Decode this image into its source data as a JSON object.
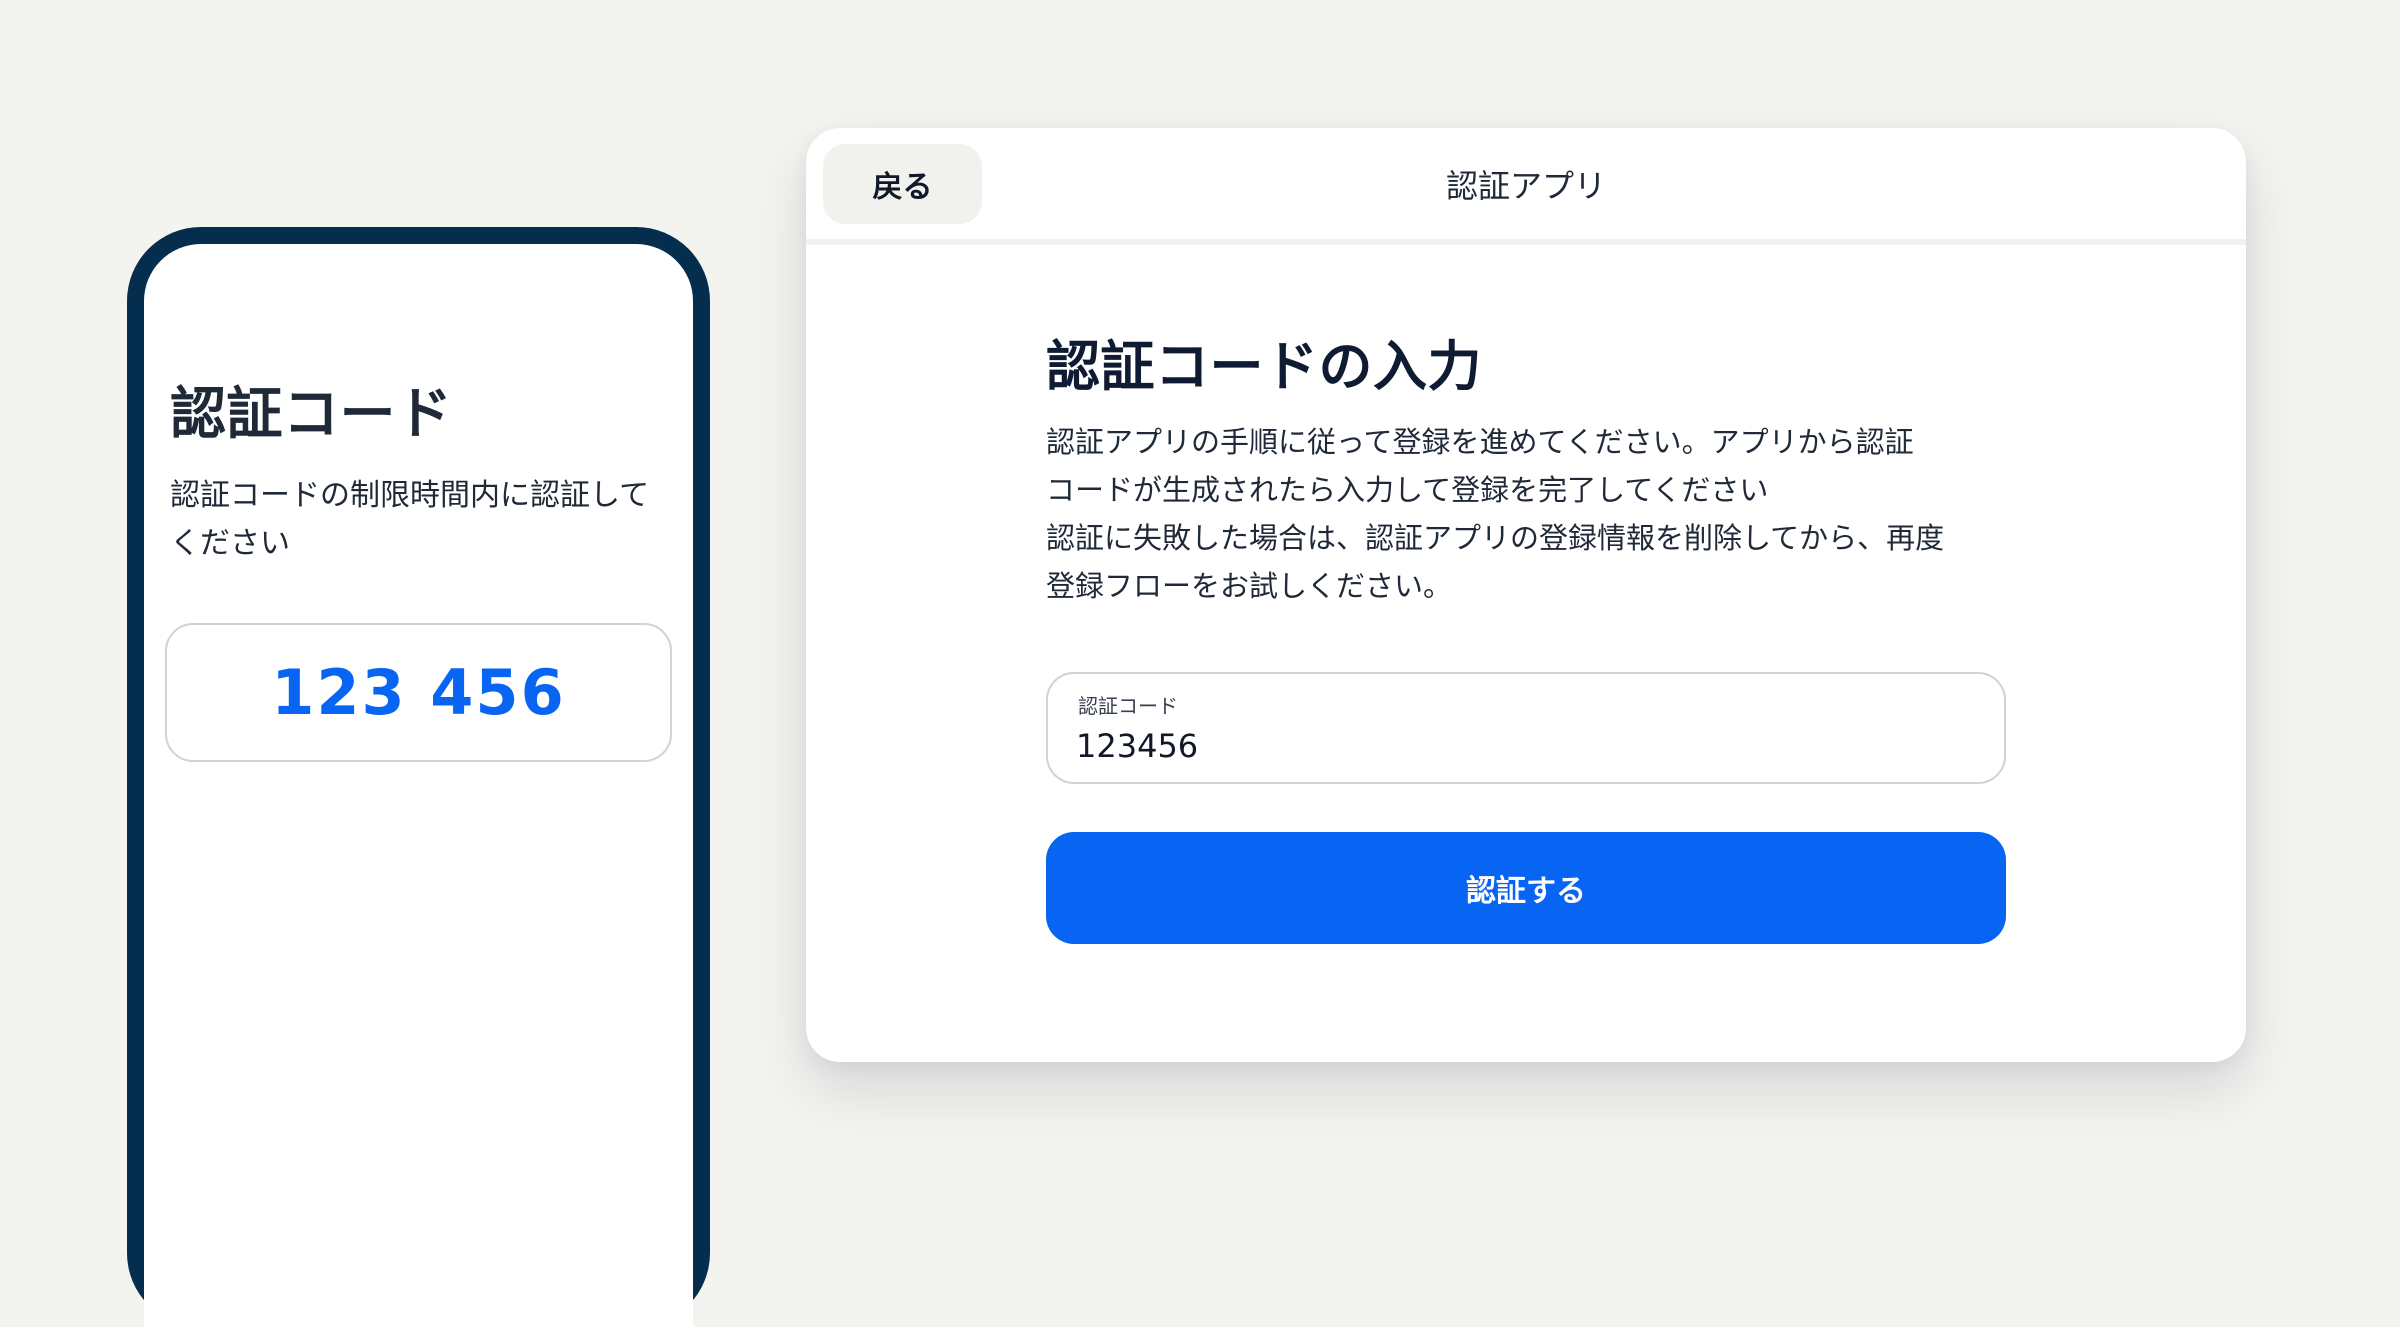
{
  "phone": {
    "title": "認証コード",
    "description": "認証コードの制限時間内に認証してください",
    "code": "123 456"
  },
  "dialog": {
    "back_label": "戻る",
    "header_title": "認証アプリ",
    "title": "認証コードの入力",
    "description_lines": [
      "認証アプリの手順に従って登録を進めてください。アプリから認証",
      "コードが生成されたら入力して登録を完了してください",
      "認証に失敗した場合は、認証アプリの登録情報を削除してから、再度",
      "登録フローをお試しください。"
    ],
    "code_field": {
      "label": "認証コード",
      "value": "123456"
    },
    "submit_label": "認証する"
  },
  "colors": {
    "background": "#F3F3F0",
    "phone_frame": "#042D4E",
    "accent": "#0864F2",
    "back_button_bg": "#F1F1ED",
    "field_border": "#CFD2D6"
  }
}
